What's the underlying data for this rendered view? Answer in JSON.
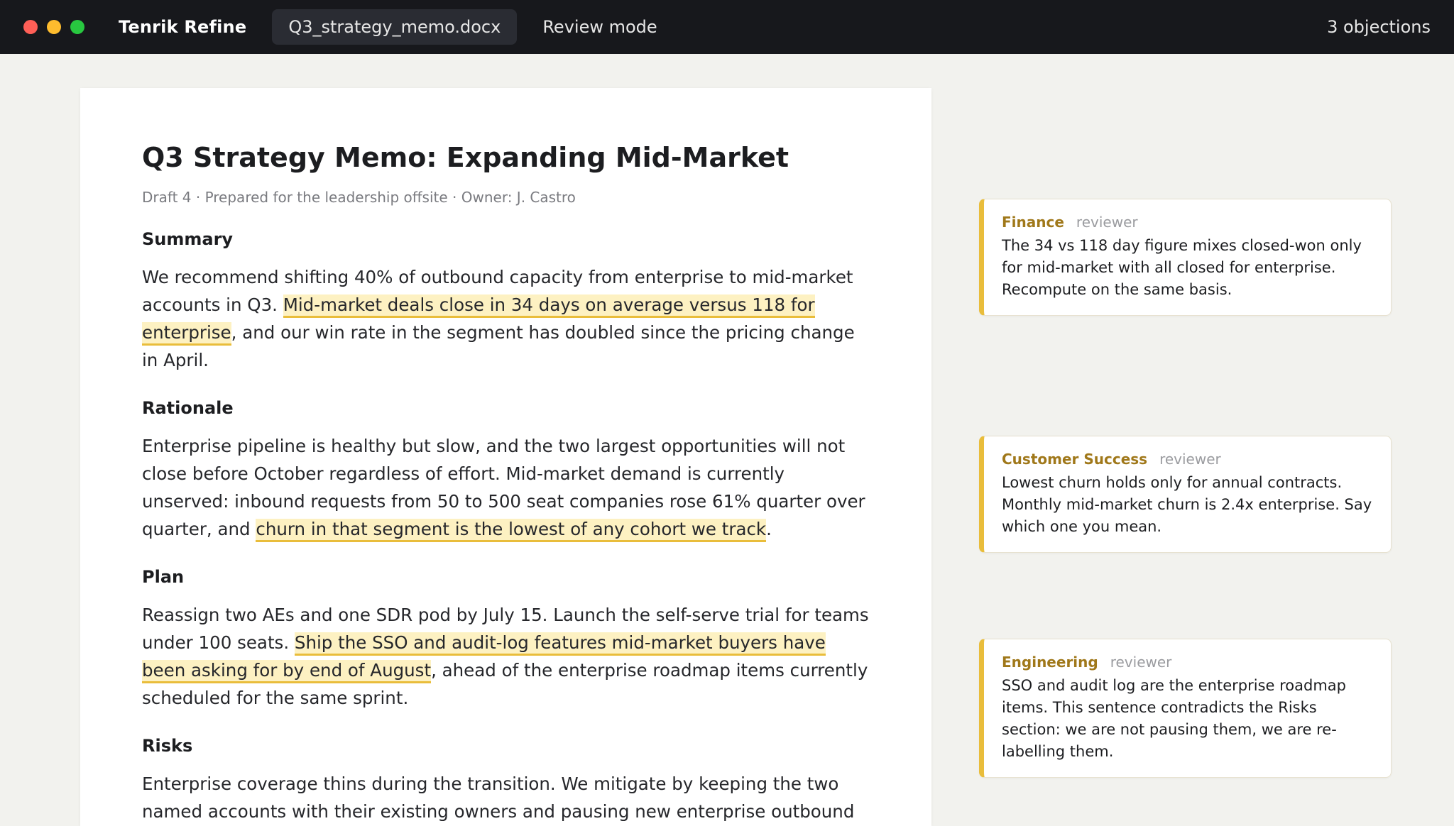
{
  "window": {
    "app_name": "Tenrik Refine",
    "file_tab": "Q3_strategy_memo.docx",
    "mode_tab": "Review mode",
    "objection_count": "3 objections"
  },
  "colors": {
    "titlebar": "#17181c",
    "highlight": "#fdf1c2",
    "highlight_underline": "#e9bd3b",
    "reviewer_accent": "#a0781a"
  },
  "doc": {
    "title": "Q3 Strategy Memo: Expanding Mid-Market",
    "meta": "Draft 4 · Prepared for the leadership offsite · Owner: J. Castro",
    "sections": {
      "summary": {
        "heading": "Summary",
        "t1": "We recommend shifting 40% of outbound capacity from enterprise to mid-market accounts in Q3. ",
        "hl": "Mid-market deals close in 34 days on average versus 118 for enterprise",
        "t2": ", and our win rate in the segment has doubled since the pricing change in April."
      },
      "rationale": {
        "heading": "Rationale",
        "t1": "Enterprise pipeline is healthy but slow, and the two largest opportunities will not close before October regardless of effort. Mid-market demand is currently unserved: inbound requests from 50 to 500 seat companies rose 61% quarter over quarter, and ",
        "hl": "churn in that segment is the lowest of any cohort we track",
        "t2": "."
      },
      "plan": {
        "heading": "Plan",
        "t1": "Reassign two AEs and one SDR pod by July 15. Launch the self-serve trial for teams under 100 seats. ",
        "hl": "Ship the SSO and audit-log features mid-market buyers have been asking for by end of August",
        "t2": ", ahead of the enterprise roadmap items currently scheduled for the same sprint."
      },
      "risks": {
        "heading": "Risks",
        "t1": "Enterprise coverage thins during the transition. We mitigate by keeping the two named accounts with their existing owners and pausing new enterprise outbound"
      }
    }
  },
  "comments": [
    {
      "reviewer": "Finance",
      "role": "reviewer",
      "text": "The 34 vs 118 day figure mixes closed-won only for mid-market with all closed for enterprise. Recompute on the same basis."
    },
    {
      "reviewer": "Customer Success",
      "role": "reviewer",
      "text": "Lowest churn holds only for annual contracts. Monthly mid-market churn is 2.4x enterprise. Say which one you mean."
    },
    {
      "reviewer": "Engineering",
      "role": "reviewer",
      "text": "SSO and audit log are the enterprise roadmap items. This sentence contradicts the Risks section: we are not pausing them, we are re-labelling them."
    }
  ]
}
